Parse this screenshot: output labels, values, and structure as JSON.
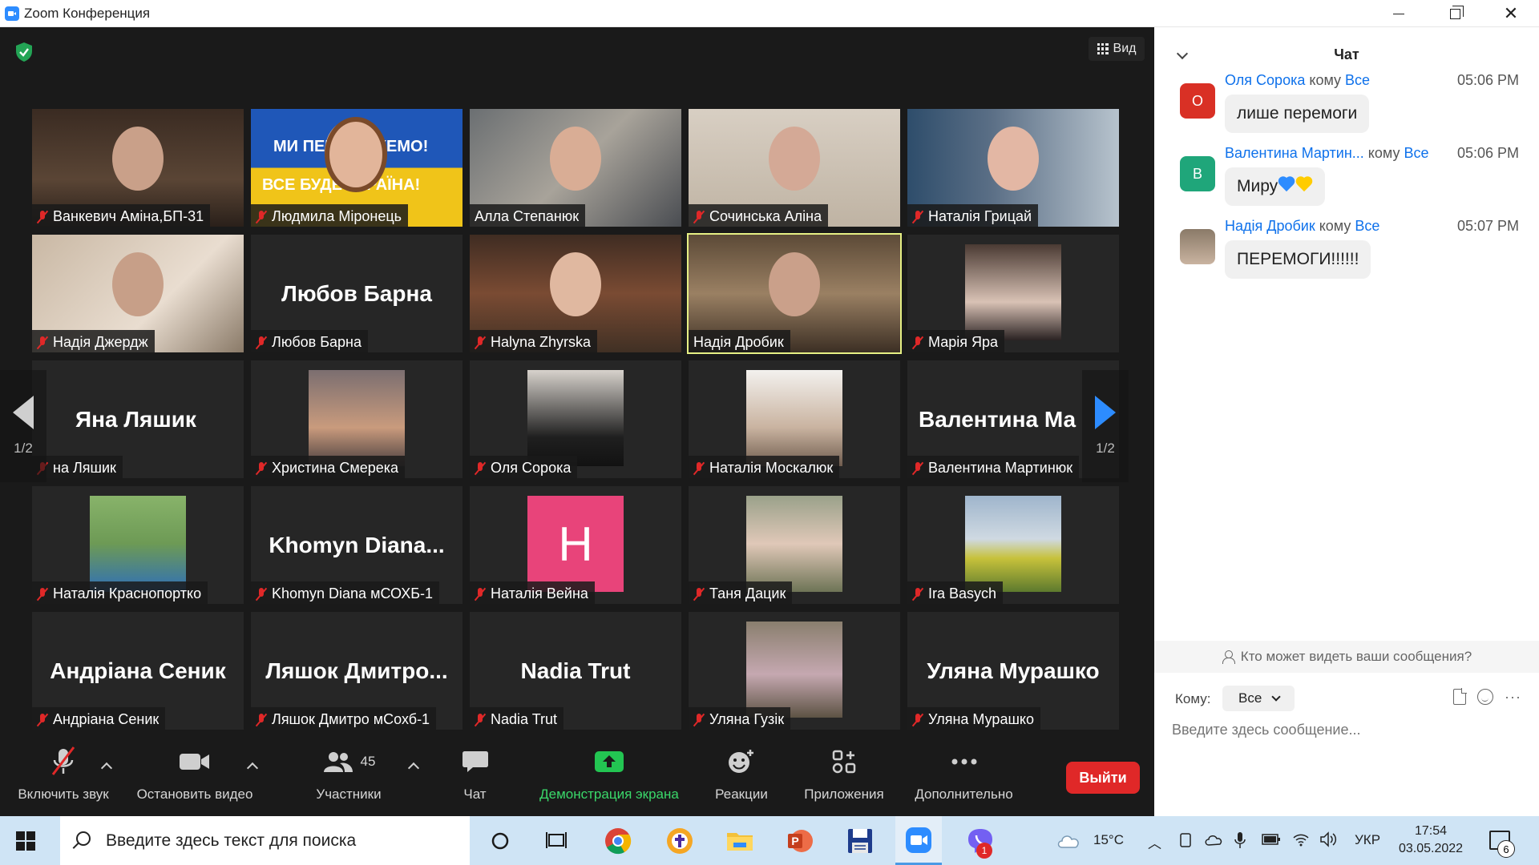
{
  "window": {
    "title": "Zoom Конференция"
  },
  "meeting": {
    "view_label": "Вид",
    "page_indicator_left": "1/2",
    "page_indicator_right": "1/2",
    "tiles": [
      {
        "name": "Ванкевич Аміна,БП-31",
        "muted": true,
        "kind": "video"
      },
      {
        "name": "Людмила Міронець",
        "muted": true,
        "kind": "video",
        "banner_top": "МИ ПЕРЕМОЖЕМО!",
        "banner_bottom": "ВСЕ БУДЕ УКРАЇНА!"
      },
      {
        "name": "Алла Степанюк",
        "muted": false,
        "kind": "video"
      },
      {
        "name": "Сочинська Аліна",
        "muted": true,
        "kind": "video"
      },
      {
        "name": "Наталія Грицай",
        "muted": true,
        "kind": "video"
      },
      {
        "name": "Надія Джердж",
        "muted": true,
        "kind": "video"
      },
      {
        "name": "Любов Барна",
        "muted": true,
        "kind": "name",
        "display_name": "Любов Барна"
      },
      {
        "name": "Halyna Zhyrska",
        "muted": true,
        "kind": "video"
      },
      {
        "name": "Надія Дробик",
        "muted": false,
        "kind": "video",
        "active_speaker": true
      },
      {
        "name": "Марія Яра",
        "muted": true,
        "kind": "photo"
      },
      {
        "name": "на Ляшик",
        "muted": true,
        "kind": "name",
        "display_name": "Яна Ляшик"
      },
      {
        "name": "Христина Смерека",
        "muted": true,
        "kind": "photo"
      },
      {
        "name": "Оля Сорока",
        "muted": true,
        "kind": "photo"
      },
      {
        "name": "Наталія Москалюк",
        "muted": true,
        "kind": "photo"
      },
      {
        "name": "Валентина Мартинюк",
        "muted": true,
        "kind": "name",
        "display_name": "Валентина Ма"
      },
      {
        "name": "Наталія Краснопортко",
        "muted": true,
        "kind": "photo"
      },
      {
        "name": "Khomyn Diana мСОХБ-1",
        "muted": true,
        "kind": "name",
        "display_name": "Khomyn Diana..."
      },
      {
        "name": "Наталія Вейна",
        "muted": true,
        "kind": "avatar",
        "initial": "Н"
      },
      {
        "name": "Таня Дацик",
        "muted": true,
        "kind": "photo"
      },
      {
        "name": "Ira Basych",
        "muted": true,
        "kind": "photo"
      },
      {
        "name": "Андріана Сеник",
        "muted": true,
        "kind": "name",
        "display_name": "Андріана Сеник"
      },
      {
        "name": "Ляшок Дмитро мСохб-1",
        "muted": true,
        "kind": "name",
        "display_name": "Ляшок Дмитро..."
      },
      {
        "name": "Nadia Trut",
        "muted": true,
        "kind": "name",
        "display_name": "Nadia Trut"
      },
      {
        "name": "Уляна Гузік",
        "muted": true,
        "kind": "photo"
      },
      {
        "name": "Уляна Мурашко",
        "muted": true,
        "kind": "name",
        "display_name": "Уляна Мурашко"
      }
    ]
  },
  "toolbar": {
    "mute_label": "Включить звук",
    "video_label": "Остановить видео",
    "participants_label": "Участники",
    "participants_count": "45",
    "chat_label": "Чат",
    "share_label": "Демонстрация экрана",
    "reactions_label": "Реакции",
    "apps_label": "Приложения",
    "more_label": "Дополнительно",
    "leave_label": "Выйти"
  },
  "chat": {
    "title": "Чат",
    "messages": [
      {
        "sender": "Оля Сорока",
        "to_word": "кому",
        "to": "Все",
        "time": "05:06 PM",
        "text": "лише перемоги",
        "avatar_letter": "О",
        "avatar_color": "#d93025"
      },
      {
        "sender": "Валентина Мартин...",
        "to_word": "кому",
        "to": "Все",
        "time": "05:06 PM",
        "text": "Миру",
        "avatar_letter": "В",
        "avatar_color": "#1fa67a"
      },
      {
        "sender": "Надія Дробик",
        "to_word": "кому",
        "to": "Все",
        "time": "05:07 PM",
        "text": "ПЕРЕМОГИ!!!!!!",
        "avatar_letter": "",
        "avatar_color": "#6b5a4a"
      }
    ],
    "who_can_see": "Кто может видеть ваши сообщения?",
    "to_label": "Кому:",
    "to_value": "Все",
    "input_placeholder": "Введите здесь сообщение..."
  },
  "taskbar": {
    "search_placeholder": "Введите здесь текст для поиска",
    "temperature": "15°C",
    "language": "УКР",
    "time": "17:54",
    "date": "03.05.2022",
    "notifications": "6",
    "viber_badge": "1"
  }
}
